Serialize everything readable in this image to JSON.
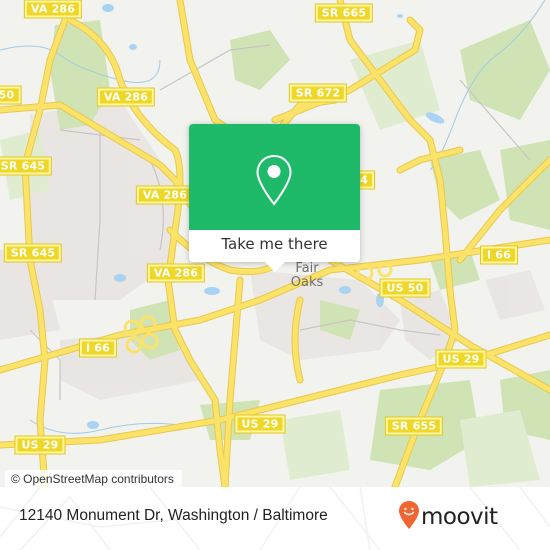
{
  "map": {
    "place_labels": [
      {
        "id": "fair-oaks",
        "text": "Fair\nOaks"
      }
    ],
    "road_shields": [
      {
        "id": "va286-top",
        "text": "VA 286"
      },
      {
        "id": "sr665",
        "text": "SR 665"
      },
      {
        "id": "us50-left",
        "text": "50"
      },
      {
        "id": "va286-mid",
        "text": "VA 286"
      },
      {
        "id": "sr672",
        "text": "SR 672"
      },
      {
        "id": "sr645-top",
        "text": "SR 645"
      },
      {
        "id": "va286-low",
        "text": "VA 286"
      },
      {
        "id": "sr-partial",
        "text": "4"
      },
      {
        "id": "sr645-low",
        "text": "SR 645"
      },
      {
        "id": "va286-bottom",
        "text": "VA 286"
      },
      {
        "id": "i66-right",
        "text": "I 66"
      },
      {
        "id": "us50-right",
        "text": "US 50"
      },
      {
        "id": "i66-left",
        "text": "I 66"
      },
      {
        "id": "us29-right",
        "text": "US 29"
      },
      {
        "id": "us29-mid",
        "text": "US 29"
      },
      {
        "id": "sr655",
        "text": "SR 655"
      },
      {
        "id": "us29-left",
        "text": "US 29"
      }
    ],
    "attribution": "© OpenStreetMap contributors"
  },
  "popup": {
    "icon": "map-pin-icon",
    "button_label": "Take me there",
    "color": "#1fb96a"
  },
  "footer": {
    "address": "12140 Monument Dr, Washington / Baltimore",
    "logo_text": "moovit",
    "logo_color": "#f26531"
  }
}
